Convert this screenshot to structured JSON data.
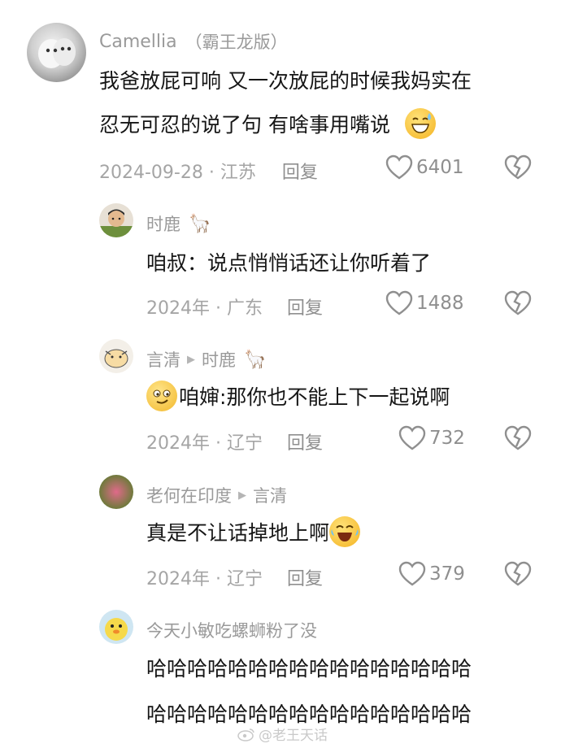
{
  "comments": [
    {
      "user": "Camellia",
      "user_suffix": "（霸王龙版）",
      "lines": [
        "我爸放屁可响 又一次放屁的时候我妈实在",
        "忍无可忍的说了句 有啥事用嘴说"
      ],
      "emoji": "grinning-sweat-emoji",
      "date_loc": "2024-09-28 · 江苏",
      "reply": "回复",
      "likes": "6401"
    },
    {
      "user": "时鹿",
      "lines": [
        "咱叔：说点悄悄话还让你听着了"
      ],
      "date_loc": "2024年 · 广东",
      "reply": "回复",
      "likes": "1488"
    },
    {
      "user": "言清",
      "reply_to": "时鹿",
      "lines": [
        "咱婶:那你也不能上下一起说啊"
      ],
      "emoji": "smirk-emoji",
      "date_loc": "2024年 · 辽宁",
      "reply": "回复",
      "likes": "732"
    },
    {
      "user": "老何在印度",
      "reply_to": "言清",
      "lines": [
        "真是不让话掉地上啊"
      ],
      "emoji": "laugh-cry-emoji",
      "date_loc": "2024年 · 辽宁",
      "reply": "回复",
      "likes": "379"
    },
    {
      "user": "今天小敏吃螺蛳粉了没",
      "lines": [
        "哈哈哈哈哈哈哈哈哈哈哈哈哈哈哈哈",
        "哈哈哈哈哈哈哈哈哈哈哈哈哈哈哈哈"
      ]
    }
  ],
  "watermark": "@老王天话",
  "colors": {
    "meta": "#a5a5a5",
    "text": "#161616",
    "name": "#9a9a9a"
  }
}
